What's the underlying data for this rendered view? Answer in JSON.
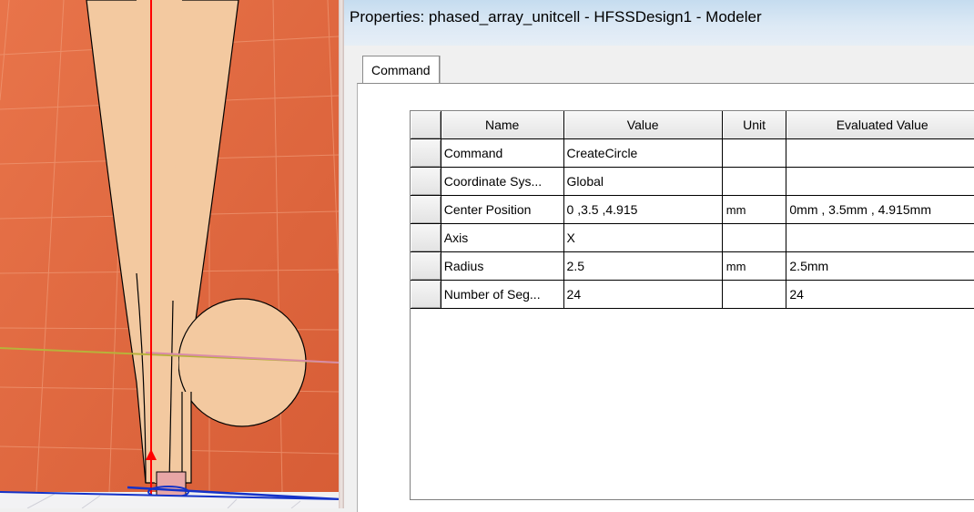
{
  "window": {
    "title": "Properties: phased_array_unitcell - HFSSDesign1 - Modeler"
  },
  "tabs": [
    {
      "label": "Command",
      "active": true
    }
  ],
  "table": {
    "columns": [
      "Name",
      "Value",
      "Unit",
      "Evaluated Value"
    ],
    "rows": [
      {
        "name": "Command",
        "value": "CreateCircle",
        "unit": "",
        "evaluated": ""
      },
      {
        "name": "Coordinate Sys...",
        "value": "Global",
        "unit": "",
        "evaluated": ""
      },
      {
        "name": "Center Position",
        "value": "0 ,3.5 ,4.915",
        "unit": "mm",
        "evaluated": "0mm , 3.5mm , 4.915mm"
      },
      {
        "name": "Axis",
        "value": "X",
        "unit": "",
        "evaluated": ""
      },
      {
        "name": "Radius",
        "value": "2.5",
        "unit": "mm",
        "evaluated": "2.5mm"
      },
      {
        "name": "Number of Seg...",
        "value": "24",
        "unit": "",
        "evaluated": "24"
      }
    ]
  },
  "colors": {
    "substrate": "#e0673f",
    "copper_patch": "#f3c9a0",
    "axis_red": "#ff0000",
    "axis_yellow": "#b8b23a",
    "axis_blue": "#1432c8",
    "axis_green": "#2e9a2e"
  }
}
